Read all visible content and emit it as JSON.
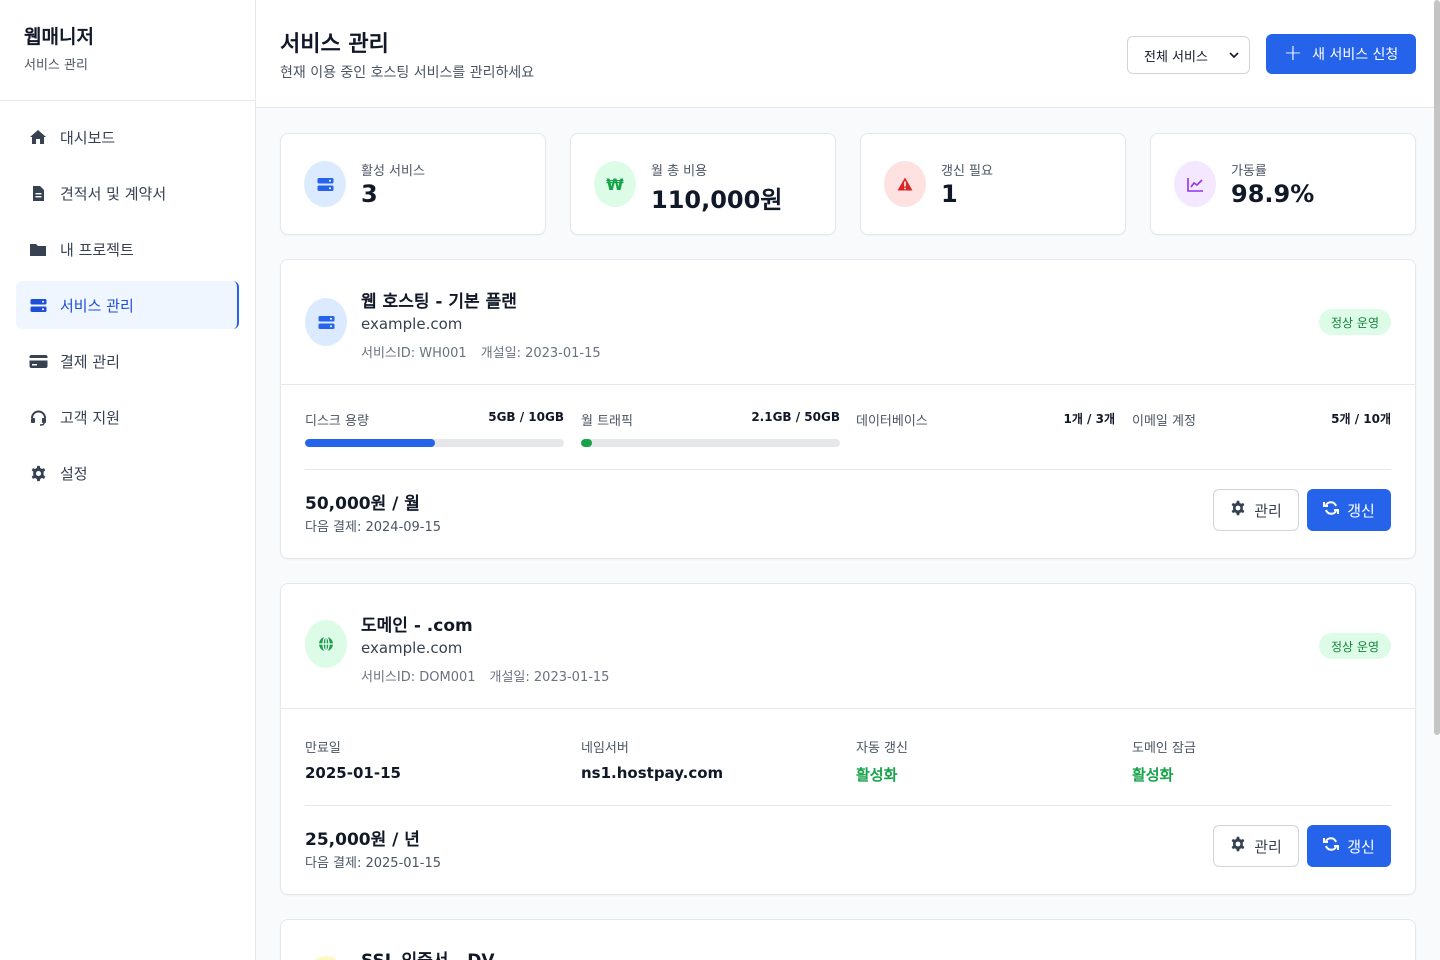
{
  "brand": {
    "title": "웹매니저",
    "subtitle": "서비스 관리"
  },
  "sidebar": {
    "items": [
      {
        "label": "대시보드",
        "icon": "home-icon"
      },
      {
        "label": "견적서 및 계약서",
        "icon": "document-icon"
      },
      {
        "label": "내 프로젝트",
        "icon": "folder-icon"
      },
      {
        "label": "서비스 관리",
        "icon": "server-icon",
        "active": true
      },
      {
        "label": "결제 관리",
        "icon": "credit-card-icon"
      },
      {
        "label": "고객 지원",
        "icon": "headset-icon"
      },
      {
        "label": "설정",
        "icon": "gear-icon"
      }
    ]
  },
  "header": {
    "title": "서비스 관리",
    "subtitle": "현재 이용 중인 호스팅 서비스를 관리하세요",
    "filter_selected": "전체 서비스",
    "new_button": "새 서비스 신청"
  },
  "stats": [
    {
      "label": "활성 서비스",
      "value": "3",
      "icon": "server-icon",
      "color": "#2563eb",
      "bg": "#dbeafe"
    },
    {
      "label": "월 총 비용",
      "value": "110,000원",
      "icon": "won-icon",
      "color": "#16a34a",
      "bg": "#dcfce7"
    },
    {
      "label": "갱신 필요",
      "value": "1",
      "icon": "warning-icon",
      "color": "#dc2626",
      "bg": "#fee2e2"
    },
    {
      "label": "가동률",
      "value": "98.9%",
      "icon": "chart-line-icon",
      "color": "#9333ea",
      "bg": "#f3e8ff"
    }
  ],
  "services": [
    {
      "name": "웹 호스팅 - 기본 플랜",
      "domain": "example.com",
      "service_id": "서비스ID: WH001",
      "opened": "개설일: 2023-01-15",
      "status": "정상 운영",
      "usage": [
        {
          "label": "디스크 용량",
          "value": "5GB / 10GB",
          "fraction": 0.5,
          "color": "#2563eb"
        },
        {
          "label": "월 트래픽",
          "value": "2.1GB / 50GB",
          "fraction": 0.042,
          "color": "#16a34a"
        },
        {
          "label": "데이터베이스",
          "value": "1개 / 3개"
        },
        {
          "label": "이메일 계정",
          "value": "5개 / 10개"
        }
      ],
      "price": "50,000원 / 월",
      "next_payment": "다음 결제: 2024-09-15",
      "manage_label": "관리",
      "renew_label": "갱신"
    },
    {
      "name": "도메인 - .com",
      "domain": "example.com",
      "service_id": "서비스ID: DOM001",
      "opened": "개설일: 2023-01-15",
      "status": "정상 운영",
      "info": [
        {
          "label": "만료일",
          "value": "2025-01-15"
        },
        {
          "label": "네임서버",
          "value": "ns1.hostpay.com"
        },
        {
          "label": "자동 갱신",
          "value": "활성화"
        },
        {
          "label": "도메인 잠금",
          "value": "활성화"
        }
      ],
      "price": "25,000원 / 년",
      "next_payment": "다음 결제: 2025-01-15",
      "manage_label": "관리",
      "renew_label": "갱신"
    },
    {
      "name": "SSL 인증서 - DV"
    }
  ]
}
